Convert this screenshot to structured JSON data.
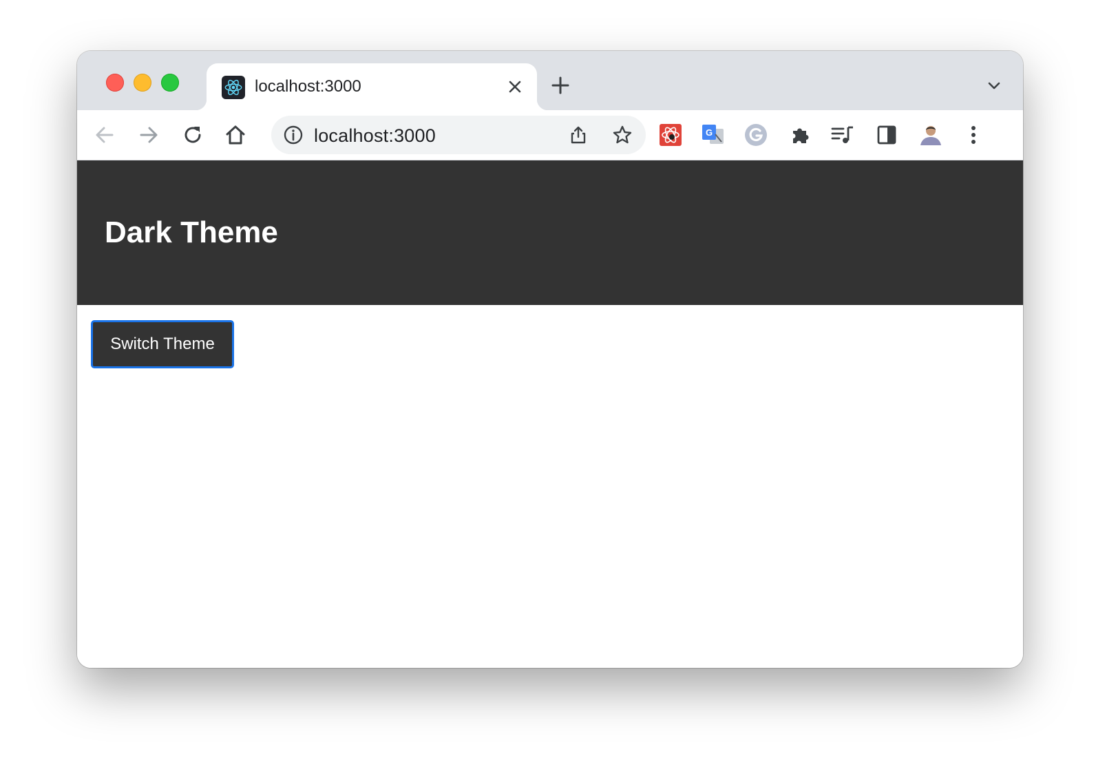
{
  "browser": {
    "tab": {
      "title": "localhost:3000",
      "favicon": "react-icon"
    },
    "address_bar": {
      "url": "localhost:3000"
    },
    "toolbar_icons": [
      "back-arrow-icon",
      "forward-arrow-icon",
      "reload-icon",
      "home-icon",
      "info-icon",
      "share-icon",
      "star-icon",
      "extension-react-devtools-icon",
      "extension-translate-icon",
      "extension-grammarly-icon",
      "extensions-puzzle-icon",
      "media-queue-icon",
      "side-panel-icon",
      "profile-avatar",
      "more-menu-icon"
    ]
  },
  "app": {
    "header_title": "Dark Theme",
    "switch_button_label": "Switch Theme"
  },
  "colors": {
    "header_bg": "#333333",
    "button_bg": "#333333",
    "button_border": "#1a73e8",
    "tabstrip_bg": "#dee1e6"
  }
}
